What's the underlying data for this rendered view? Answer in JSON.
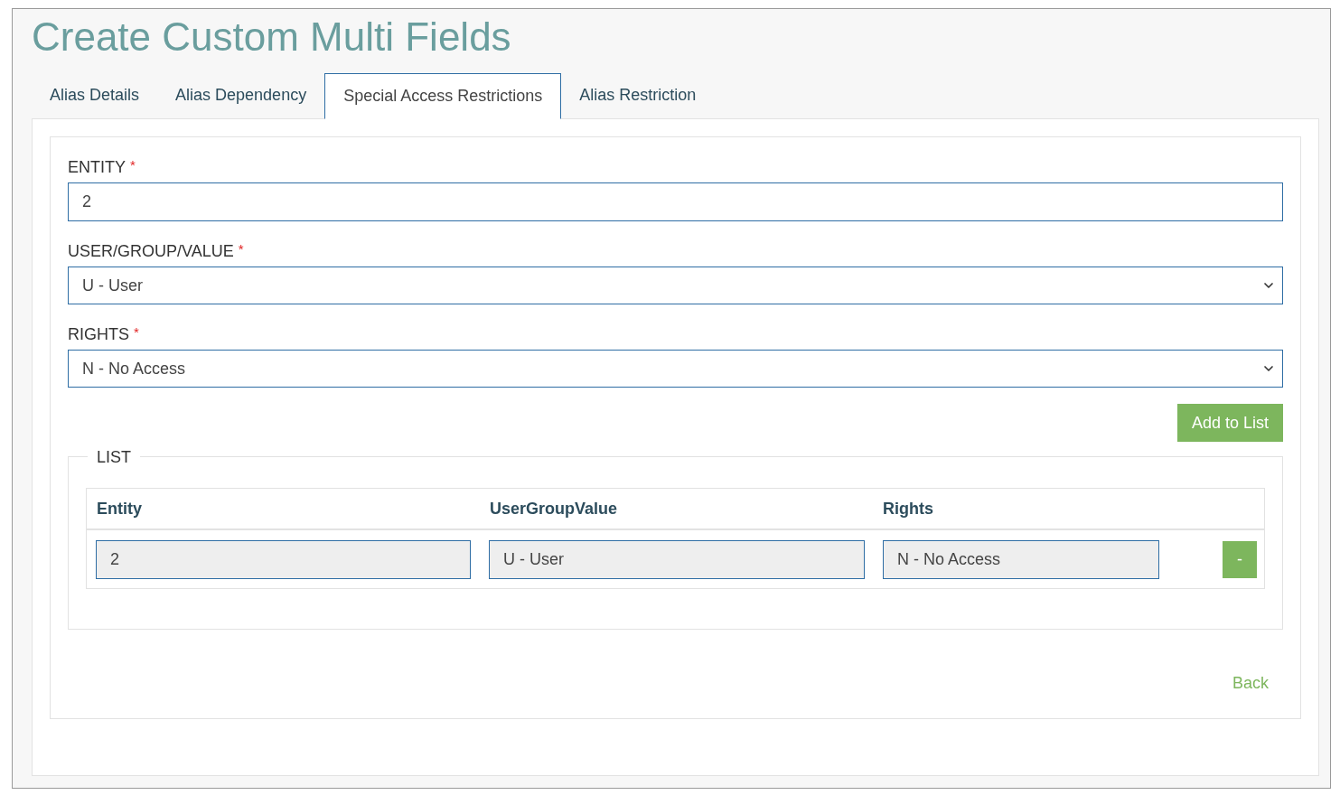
{
  "page": {
    "title": "Create Custom Multi Fields"
  },
  "tabs": [
    {
      "label": "Alias Details",
      "selected": false
    },
    {
      "label": "Alias Dependency",
      "selected": false
    },
    {
      "label": "Special Access Restrictions",
      "selected": true
    },
    {
      "label": "Alias Restriction",
      "selected": false
    }
  ],
  "form": {
    "fields": [
      {
        "kind": "text",
        "label": "ENTITY",
        "required_mark": "*",
        "value": "2"
      },
      {
        "kind": "select",
        "label": "USER/GROUP/VALUE",
        "required_mark": "*",
        "value": "U - User"
      },
      {
        "kind": "select",
        "label": "RIGHTS",
        "required_mark": "*",
        "value": "N - No Access"
      }
    ],
    "add_button": "Add to List"
  },
  "list": {
    "legend": "LIST",
    "columns": [
      "Entity",
      "UserGroupValue",
      "Rights"
    ],
    "rows": [
      {
        "cells": [
          "2",
          "U - User",
          "N - No Access"
        ],
        "remove_button": "-"
      }
    ]
  },
  "back_link": "Back"
}
